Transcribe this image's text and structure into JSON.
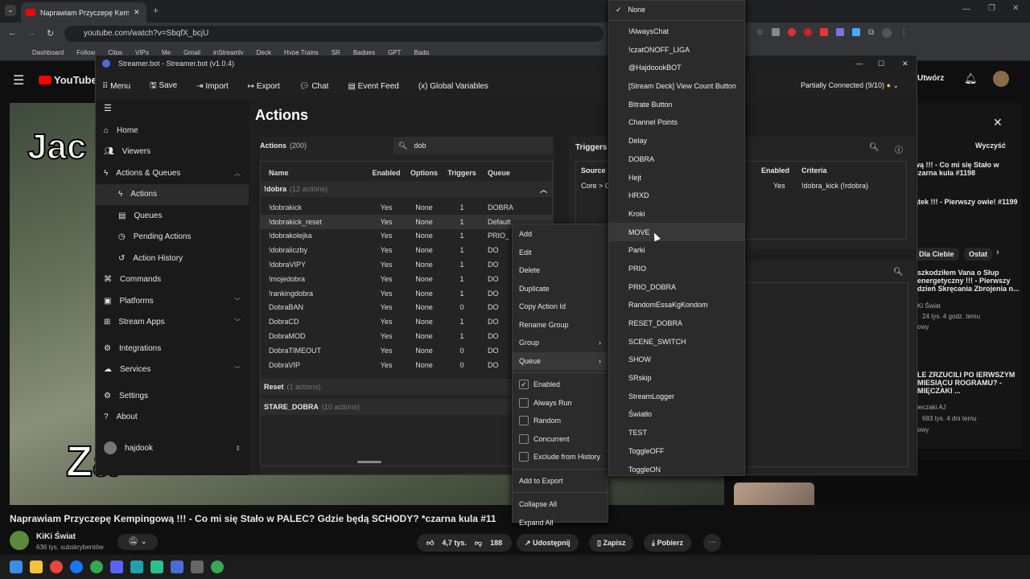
{
  "browser": {
    "tab_title": "Naprawiam Przyczepę Kempingową",
    "url": "youtube.com/watch?v=SbqfX_bcjU",
    "bookmarks": [
      "Dashboard",
      "Follow",
      "Clips",
      "VIPs",
      "Me",
      "Gmail",
      "inStreamly",
      "Deck",
      "Hype Trains",
      "SR",
      "Badges",
      "GPT",
      "Badg"
    ]
  },
  "youtube": {
    "logo": "YouTube",
    "create_label": "Utwórz",
    "video_title": "Naprawiam Przyczepę Kempingową !!! - Co mi się Stało w PALEC? Gdzie będą SCHODY? *czarna kula #11",
    "channel": "KiKi Świat",
    "subs": "636 tys. subskrybentów",
    "likes": "4,7 tys.",
    "dislikes": "188",
    "share": "Udostępnij",
    "save": "Zapisz",
    "download": "Pobierz",
    "overlay_top": "Jac",
    "overlay_bottom": "Za",
    "rail": {
      "close": "Wyczyść",
      "chip1": "Dla Ciebie",
      "chip2": "Ostat",
      "items": [
        "wą !!! - Co mi się Stało w czarna kula #1198",
        "ątek !!! - Pierwszy owie! #1199",
        "szkodziłem Vana o Słup energetyczny !!! - Pierwszy dzień Skręcania Zbrojenia n...",
        "Ki Świat",
        "24 tys.  4 godz. temu",
        "owy",
        "LE ZRZUCILI PO IERWSZYM MIESIĄCU ROGRAMU? - MIĘCZAKI ...",
        "ieczaki AJ",
        "683 tys.  4 dni temu",
        "owy"
      ]
    }
  },
  "app": {
    "title": "Streamer.bot - Streamer.bot (v1.0.4)",
    "connection": "Partially Connected (9/10)",
    "menu": [
      "Menu",
      "Save",
      "Import",
      "Export",
      "Chat",
      "Event Feed",
      "Global Variables"
    ],
    "nav": [
      "Home",
      "Viewers",
      "Actions & Queues",
      "Actions",
      "Queues",
      "Pending Actions",
      "Action History",
      "Commands",
      "Platforms",
      "Stream Apps",
      "Integrations",
      "Services",
      "Settings",
      "About"
    ],
    "user": "hajdook",
    "page_title": "Actions",
    "actions_label": "Actions",
    "actions_count": "(200)",
    "search_value": "dob",
    "columns": [
      "Name",
      "Enabled",
      "Options",
      "Triggers",
      "Queue"
    ],
    "group1": "!dobra",
    "group1_count": "(12 actions)",
    "rows": [
      [
        "!dobrakick",
        "Yes",
        "None",
        "1",
        "DOBRA"
      ],
      [
        "!dobrakick_reset",
        "Yes",
        "None",
        "1",
        "Default"
      ],
      [
        "!dobrakolejka",
        "Yes",
        "None",
        "1",
        "PRIO_"
      ],
      [
        "!dobraliczby",
        "Yes",
        "None",
        "1",
        "DO"
      ],
      [
        "!dobraVIPY",
        "Yes",
        "None",
        "1",
        "DO"
      ],
      [
        "!mojedobra",
        "Yes",
        "None",
        "1",
        "DO"
      ],
      [
        "!rankingdobra",
        "Yes",
        "None",
        "1",
        "DO"
      ],
      [
        "DobraBAN",
        "Yes",
        "None",
        "0",
        "DO"
      ],
      [
        "DobraCD",
        "Yes",
        "None",
        "1",
        "DO"
      ],
      [
        "DobraMOD",
        "Yes",
        "None",
        "1",
        "DO"
      ],
      [
        "DobraTIMEOUT",
        "Yes",
        "None",
        "0",
        "DO"
      ],
      [
        "DobraVIP",
        "Yes",
        "None",
        "0",
        "DO"
      ]
    ],
    "group2": "Reset",
    "group2_count": "(1 actions)",
    "group3": "STARE_DOBRA",
    "group3_count": "(10 actions)",
    "triggers": {
      "title": "Triggers",
      "cols": [
        "Source",
        "Enabled",
        "Criteria"
      ],
      "row": [
        "Core > C",
        "Yes",
        "!dobra_kick (!rdobra)"
      ]
    }
  },
  "context_menu": {
    "items": [
      "Add",
      "Edit",
      "Delete",
      "Duplicate",
      "Copy Action Id",
      "Rename Group",
      "Group",
      "Queue"
    ],
    "checks": [
      {
        "label": "Enabled",
        "checked": true
      },
      {
        "label": "Always Run",
        "checked": false
      },
      {
        "label": "Random",
        "checked": false
      },
      {
        "label": "Concurrent",
        "checked": false
      },
      {
        "label": "Exclude from History",
        "checked": false
      }
    ],
    "bottom": [
      "Add to Export",
      "Collapse All",
      "Expand All"
    ]
  },
  "queue_menu": {
    "selected": "None",
    "items": [
      "!AlwaysChat",
      "!czatONOFF_LIGA",
      "@HajdoookBOT",
      "[Stream Deck] View Count Button",
      "Bitrate Button",
      "Channel Points",
      "Delay",
      "DOBRA",
      "Hejt",
      "HRXD",
      "Kroki",
      "MOVE",
      "Parki",
      "PRIO",
      "PRIO_DOBRA",
      "RandomEssaKgKondom",
      "RESET_DOBRA",
      "SCENE_SWITCH",
      "SHOW",
      "SRskip",
      "StreamLogger",
      "Światło",
      "TEST",
      "ToggleOFF",
      "ToggleON"
    ],
    "hovered": "MOVE"
  }
}
